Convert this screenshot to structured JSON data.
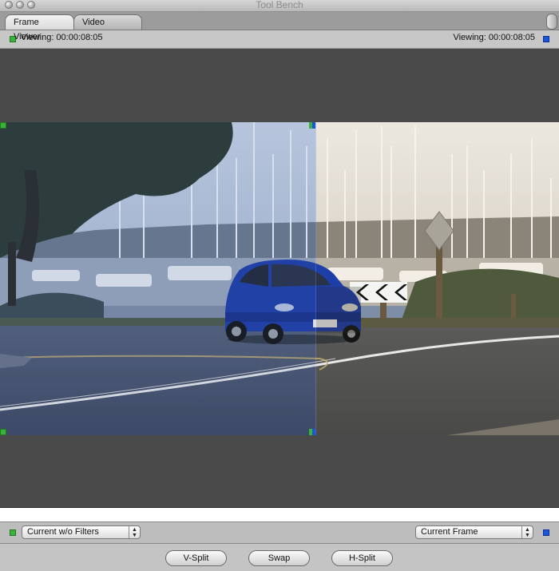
{
  "window": {
    "title": "Tool Bench"
  },
  "tabs": [
    {
      "label": "Frame Viewer",
      "active": true
    },
    {
      "label": "Video Scopes",
      "active": false
    }
  ],
  "info": {
    "left_label": "Viewing: 00:00:08:05",
    "right_label": "Viewing: 00:00:08:05",
    "left_indicator_color": "#39b43a",
    "right_indicator_color": "#1a55e0"
  },
  "controls": {
    "left_select": {
      "value": "Current w/o Filters"
    },
    "right_select": {
      "value": "Current Frame"
    }
  },
  "buttons": {
    "v_split": "V-Split",
    "swap": "Swap",
    "h_split": "H-Split"
  },
  "icons": [
    "green-square-icon",
    "blue-square-icon",
    "stepper-arrows-icon",
    "close-button-icon",
    "minimize-button-icon",
    "zoom-button-icon"
  ]
}
